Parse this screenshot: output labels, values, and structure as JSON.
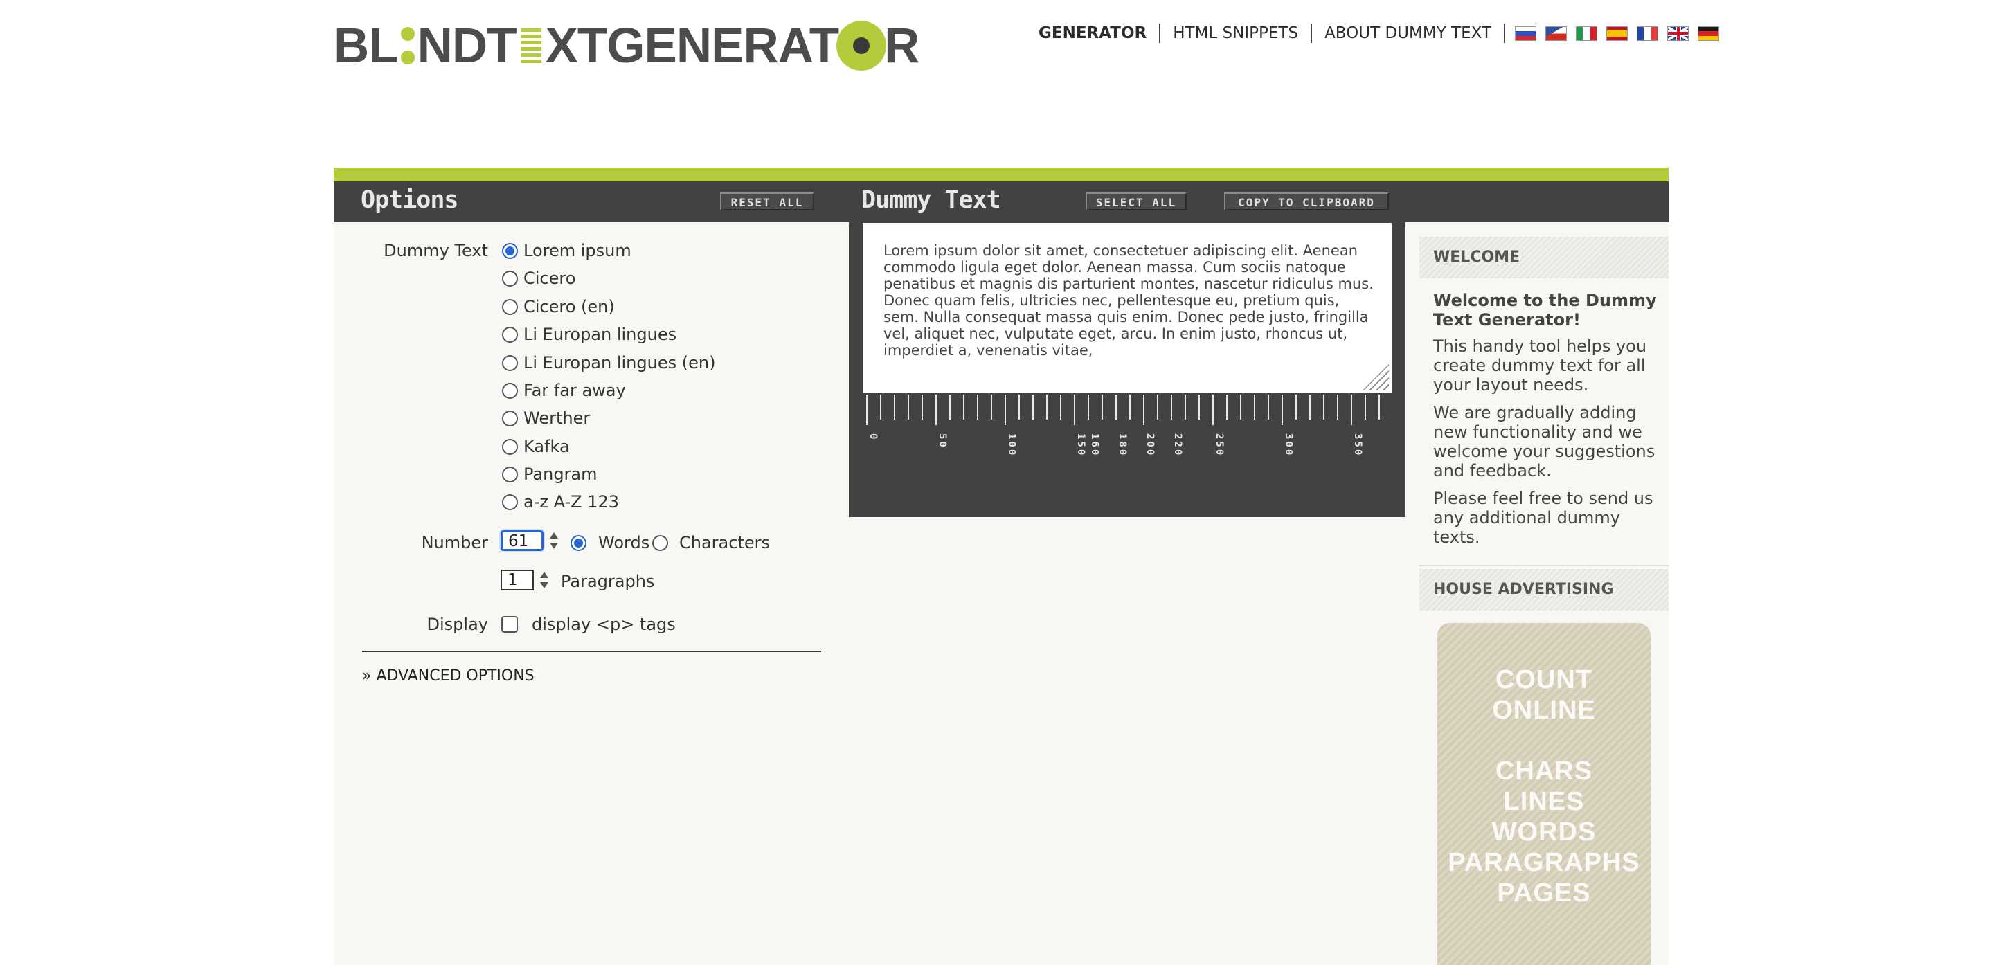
{
  "logo": {
    "part1": "BL",
    "part2": "NDT",
    "part3": "XTGENERAT",
    "part4": "R"
  },
  "nav": {
    "items": [
      "GENERATOR",
      "HTML SNIPPETS",
      "ABOUT DUMMY TEXT"
    ],
    "flags": [
      "flag-ru",
      "flag-cz",
      "flag-it",
      "flag-es",
      "flag-fr",
      "flag-gb",
      "flag-de"
    ]
  },
  "options_panel": {
    "title": "Options",
    "reset_label": "RESET ALL",
    "dummy_text_label": "Dummy Text",
    "dummy_texts": [
      "Lorem ipsum",
      "Cicero",
      "Cicero (en)",
      "Li Europan lingues",
      "Li Europan lingues (en)",
      "Far far away",
      "Werther",
      "Kafka",
      "Pangram",
      "a-z A-Z 123"
    ],
    "selected_dummy_text": "Lorem ipsum",
    "number_label": "Number",
    "number_value": "61",
    "words_label": "Words",
    "characters_label": "Characters",
    "unit_selected": "Words",
    "paragraphs_value": "1",
    "paragraphs_label": "Paragraphs",
    "display_label": "Display",
    "display_p_tags_label": "display <p> tags",
    "advanced_label": "» ADVANCED OPTIONS"
  },
  "output_panel": {
    "title": "Dummy Text",
    "select_all_label": "SELECT ALL",
    "copy_label": "COPY TO CLIPBOARD",
    "text": "Lorem ipsum dolor sit amet, consectetuer adipiscing elit. Aenean commodo ligula eget dolor. Aenean massa. Cum sociis natoque penatibus et magnis dis parturient montes, nascetur ridiculus mus. Donec quam felis, ultricies nec, pellentesque eu, pretium quis, sem. Nulla consequat massa quis enim. Donec pede justo, fringilla vel, aliquet nec, vulputate eget, arcu. In enim justo, rhoncus ut, imperdiet a, venenatis vitae,",
    "ruler_labels": [
      "0",
      "50",
      "100",
      "150",
      "160",
      "180",
      "200",
      "220",
      "250",
      "300",
      "350"
    ]
  },
  "sidebar": {
    "welcome_heading": "WELCOME",
    "welcome_title": "Welcome to the Dummy Text Generator!",
    "welcome_paragraphs": [
      "This handy tool helps you create dummy text for all your layout needs.",
      "We are gradually adding new functionality and we welcome your suggestions and feedback.",
      "Please feel free to send us any additional dummy texts."
    ],
    "ad_heading": "HOUSE ADVERTISING",
    "ad_lines": [
      "COUNT",
      "ONLINE",
      "",
      "CHARS",
      "LINES",
      "WORDS",
      "PARAGRAPHS",
      "PAGES"
    ]
  },
  "colors": {
    "accent": "#b4cc3c",
    "panel_dark": "#424242",
    "focus_blue": "#2563d9"
  }
}
